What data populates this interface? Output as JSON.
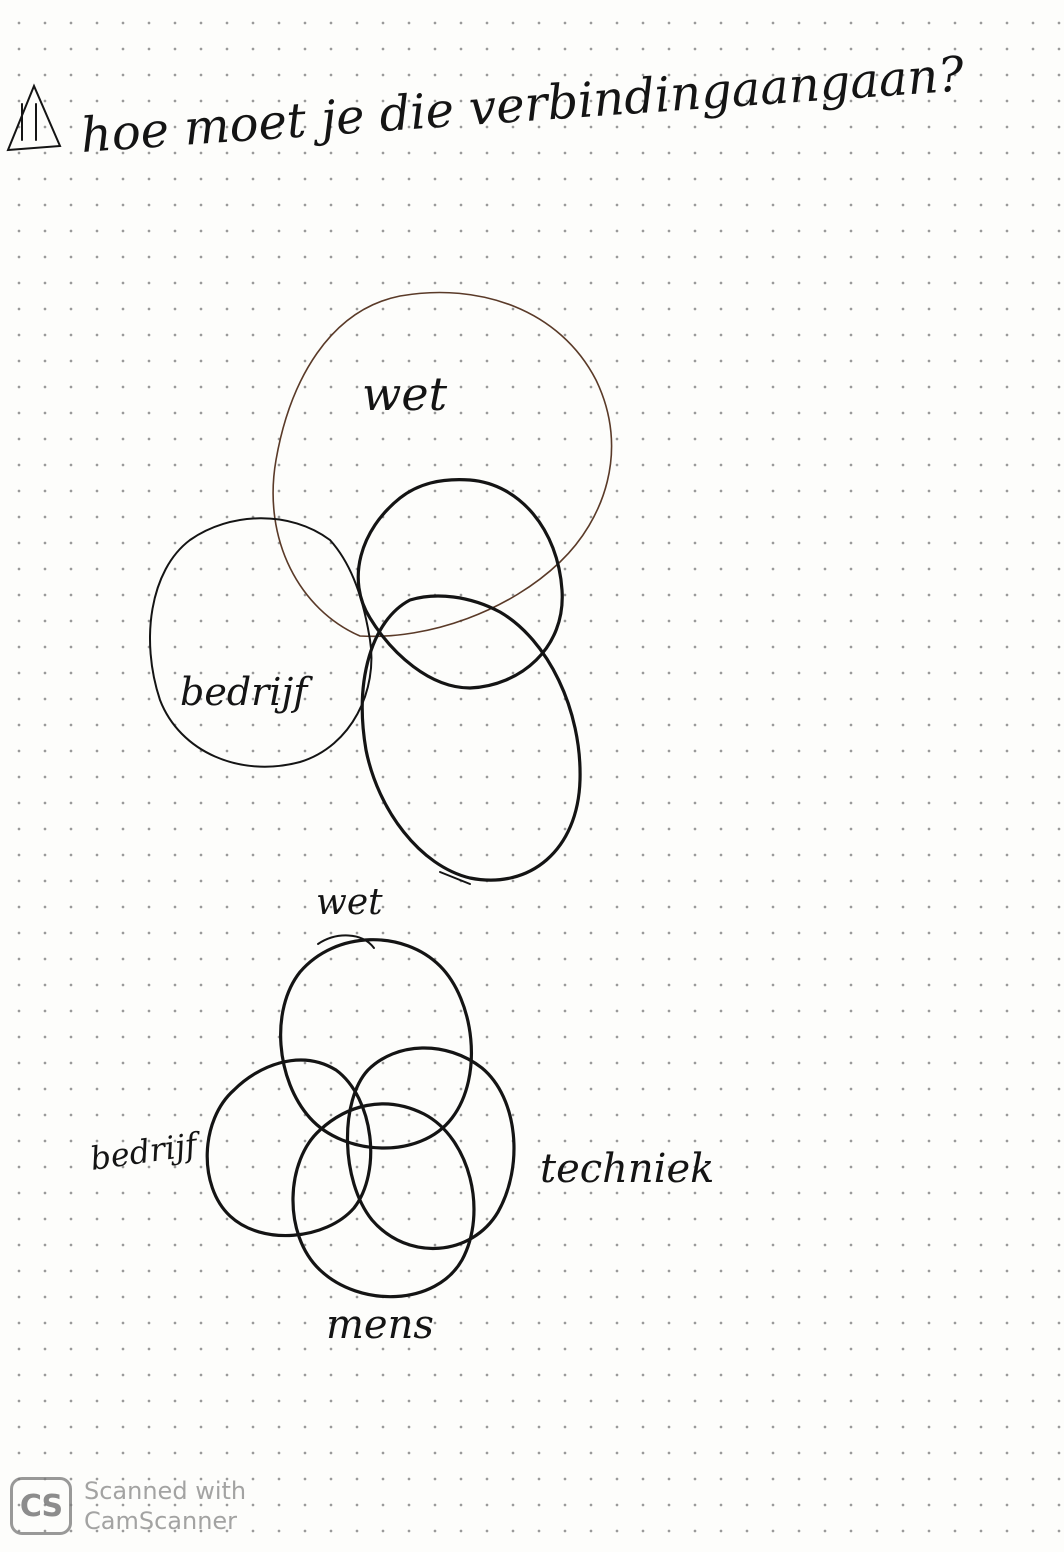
{
  "header": {
    "index_mark": "I",
    "question": "hoe moet je die verbindingaangaan?"
  },
  "diagram_top": {
    "labels": {
      "wet": "wet",
      "bedrijf": "bedrijf"
    }
  },
  "diagram_bottom": {
    "labels": {
      "wet": "wet",
      "bedrijf": "bedrijf",
      "techniek": "techniek",
      "mens": "mens"
    }
  },
  "scanner_badge": {
    "logo_text": "CS",
    "line1": "Scanned with",
    "line2": "CamScanner"
  },
  "colors": {
    "ink": "#141414",
    "pencil_brown": "#5a3a28",
    "paper": "#fdfdfb"
  }
}
